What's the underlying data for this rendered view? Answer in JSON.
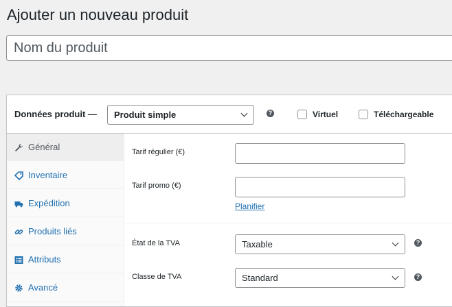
{
  "page_title": "Ajouter un nouveau produit",
  "product_name": {
    "placeholder": "Nom du produit",
    "value": ""
  },
  "product_data": {
    "label": "Données produit —",
    "product_type": "Produit simple",
    "help_glyph": "?",
    "virtual_label": "Virtuel",
    "downloadable_label": "Téléchargeable"
  },
  "tabs": [
    {
      "label": "Général",
      "icon": "wrench-icon",
      "active": true
    },
    {
      "label": "Inventaire",
      "icon": "tag-icon",
      "active": false
    },
    {
      "label": "Expédition",
      "icon": "truck-icon",
      "active": false
    },
    {
      "label": "Produits liés",
      "icon": "link-icon",
      "active": false
    },
    {
      "label": "Attributs",
      "icon": "list-icon",
      "active": false
    },
    {
      "label": "Avancé",
      "icon": "gear-icon",
      "active": false
    }
  ],
  "general": {
    "regular_price_label": "Tarif régulier (€)",
    "regular_price_value": "",
    "sale_price_label": "Tarif promo (€)",
    "sale_price_value": "",
    "schedule_link": "Planifier",
    "tax_status_label": "État de la TVA",
    "tax_status_value": "Taxable",
    "tax_class_label": "Classe de TVA",
    "tax_class_value": "Standard"
  },
  "colors": {
    "link": "#2271b1",
    "border": "#8c8f94",
    "background": "#f0f0f1"
  }
}
